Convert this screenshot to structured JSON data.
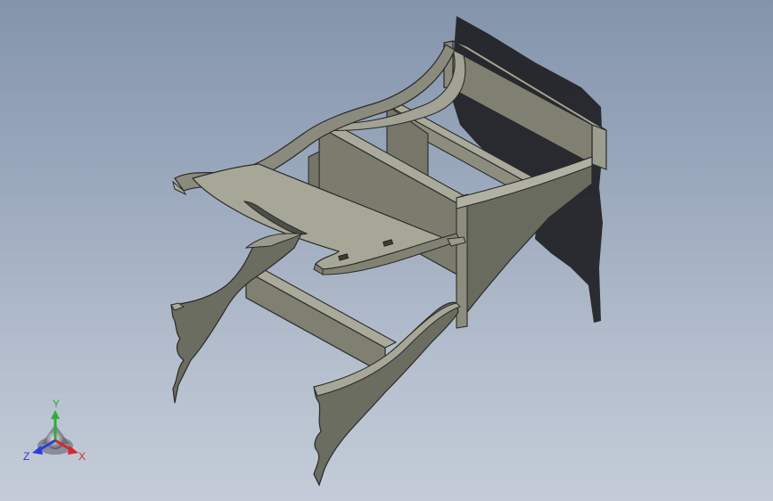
{
  "view": {
    "background_top": "#8394ab",
    "background_bottom": "#c4ccd8",
    "part_face_color": "#7f8071",
    "part_edge_color": "#2a2a2a",
    "shadow_color": "#1f1f24"
  },
  "model": {
    "parts": [
      "shadow",
      "back-board",
      "upper-slat-far",
      "upper-slat-mid",
      "upper-right-side-panel",
      "upper-left-side-panel",
      "seat-board",
      "lower-slat",
      "lower-left-side-panel",
      "lower-right-side-panel"
    ]
  },
  "triad": {
    "icon": "coordinate-triad-icon",
    "x_label": "X",
    "y_label": "Y",
    "z_label": "Z",
    "x_color": "#d42a2a",
    "y_color": "#2fae3a",
    "z_color": "#2a3fd8"
  }
}
